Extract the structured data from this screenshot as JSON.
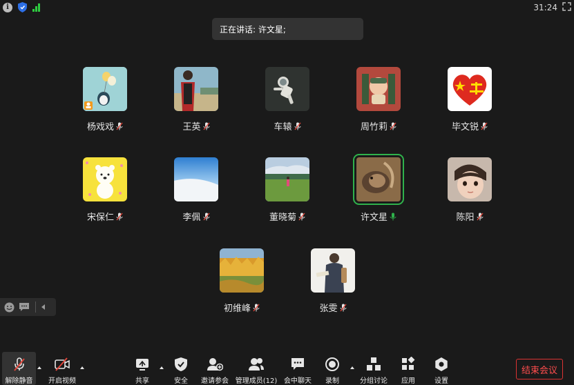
{
  "status_bar": {
    "info_icon": "info-icon",
    "shield_icon": "shield-icon",
    "signal_icon": "signal-icon",
    "timer": "31:24",
    "fullscreen_icon": "fullscreen-icon",
    "accent_green": "#2ecc40",
    "accent_blue": "#2d6fe6"
  },
  "speaker_banner": {
    "text": "正在讲话: 许文星;"
  },
  "participants": [
    {
      "name": "杨戏戏",
      "avatar": "balloon-penguin",
      "speaking": false
    },
    {
      "name": "王英",
      "avatar": "portrait-red-scarf",
      "speaking": false
    },
    {
      "name": "车辕",
      "avatar": "astronaut",
      "speaking": false
    },
    {
      "name": "周竹莉",
      "avatar": "cartoon-character",
      "speaking": false
    },
    {
      "name": "毕文锐",
      "avatar": "heart-flag",
      "speaking": false
    },
    {
      "name": "宋保仁",
      "avatar": "polar-bear",
      "speaking": false
    },
    {
      "name": "李佩",
      "avatar": "sky-snow",
      "speaking": false
    },
    {
      "name": "董晓菊",
      "avatar": "field-landscape",
      "speaking": false
    },
    {
      "name": "许文星",
      "avatar": "bird-close-up",
      "speaking": true
    },
    {
      "name": "陈阳",
      "avatar": "child-portrait",
      "speaking": false
    },
    {
      "name": "初维峰",
      "avatar": "autumn-trees",
      "speaking": false
    },
    {
      "name": "张雯",
      "avatar": "reading-person",
      "speaking": false
    }
  ],
  "side_tools": {
    "emoji_icon": "emoji-icon",
    "chat_icon": "chat-bubble-icon",
    "collapse_icon": "collapse-left-icon"
  },
  "toolbar": {
    "unmute": "解除静音",
    "start_video": "开启视频",
    "share": "共享",
    "security": "安全",
    "invite": "邀请参会",
    "manage_members": "管理成员(12)",
    "chat": "会中聊天",
    "record": "录制",
    "breakout": "分组讨论",
    "apps": "应用",
    "settings": "设置",
    "end_meeting": "结束会议",
    "end_color": "#ff4d4d"
  }
}
